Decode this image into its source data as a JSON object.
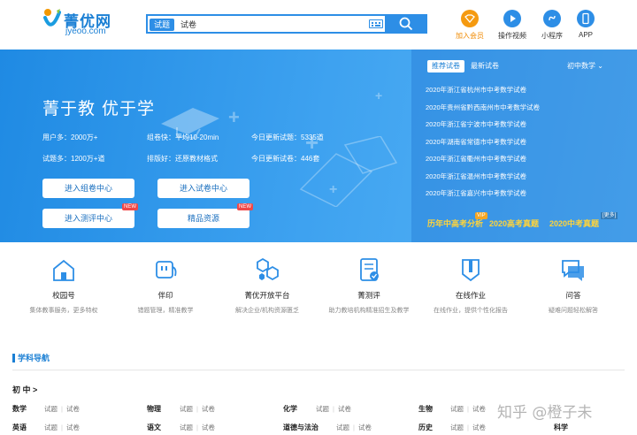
{
  "header": {
    "logo_name": "菁优网",
    "logo_url": "jyeoo.com",
    "search": {
      "tab_active": "试题",
      "tab_other": "试卷",
      "placeholder": ""
    },
    "links": [
      {
        "label": "加入会员",
        "icon": "vip-icon",
        "color": "#f59a10"
      },
      {
        "label": "操作视频",
        "icon": "play-icon",
        "color": "#2d8ee6"
      },
      {
        "label": "小程序",
        "icon": "miniprogram-icon",
        "color": "#2d8ee6"
      },
      {
        "label": "APP",
        "icon": "phone-icon",
        "color": "#2d8ee6"
      }
    ]
  },
  "banner": {
    "slogan": "菁于教 优于学",
    "stats": [
      "用户多：2000万+",
      "组卷快：平均10-20min",
      "今日更新试题：5335道",
      "试题多：1200万+道",
      "排版好：还原教材格式",
      "今日更新试卷：446套"
    ],
    "buttons": [
      {
        "label": "进入组卷中心",
        "tag": ""
      },
      {
        "label": "进入试卷中心",
        "tag": ""
      },
      {
        "label": "进入测评中心",
        "tag": "NEW"
      },
      {
        "label": "精品资源",
        "tag": "NEW"
      }
    ],
    "panel": {
      "tab_active": "推荐试卷",
      "tab_other": "最新试卷",
      "grade": "初中数学",
      "papers": [
        "2020年浙江省杭州市中考数学试卷",
        "2020年贵州省黔西南州市中考数学试卷",
        "2020年浙江省宁波市中考数学试卷",
        "2020年湖南省常德市中考数学试卷",
        "2020年浙江省衢州市中考数学试卷",
        "2020年浙江省温州市中考数学试卷",
        "2020年浙江省嘉兴市中考数学试卷"
      ],
      "foot": [
        "历年中高考分析",
        "2020高考真题",
        "2020中考真题"
      ],
      "vip": "VIP",
      "more": "[更多]"
    }
  },
  "services": [
    {
      "name": "校园号",
      "desc": "集体教事服务，更多特权",
      "icon": "school-icon"
    },
    {
      "name": "伴印",
      "desc": "错题管理，精准教学",
      "icon": "print-icon"
    },
    {
      "name": "菁优开放平台",
      "desc": "解决企业/机构资源匮乏",
      "icon": "platform-icon"
    },
    {
      "name": "菁测评",
      "desc": "助力教培机构精准招生及教学",
      "icon": "assess-icon"
    },
    {
      "name": "在线作业",
      "desc": "在线作业，提供个性化报告",
      "icon": "homework-icon"
    },
    {
      "name": "问答",
      "desc": "疑难问题轻松解答",
      "icon": "qa-icon"
    }
  ],
  "subject_nav": {
    "title": "学科导航",
    "level": "初 中 >",
    "link_a": "试题",
    "link_b": "试卷",
    "rows": [
      [
        "数学",
        "物理",
        "化学",
        "生物"
      ],
      [
        "英语",
        "语文",
        "道德与法治",
        "历史"
      ]
    ],
    "extra": "科学"
  },
  "watermark": "知乎 @橙子未"
}
